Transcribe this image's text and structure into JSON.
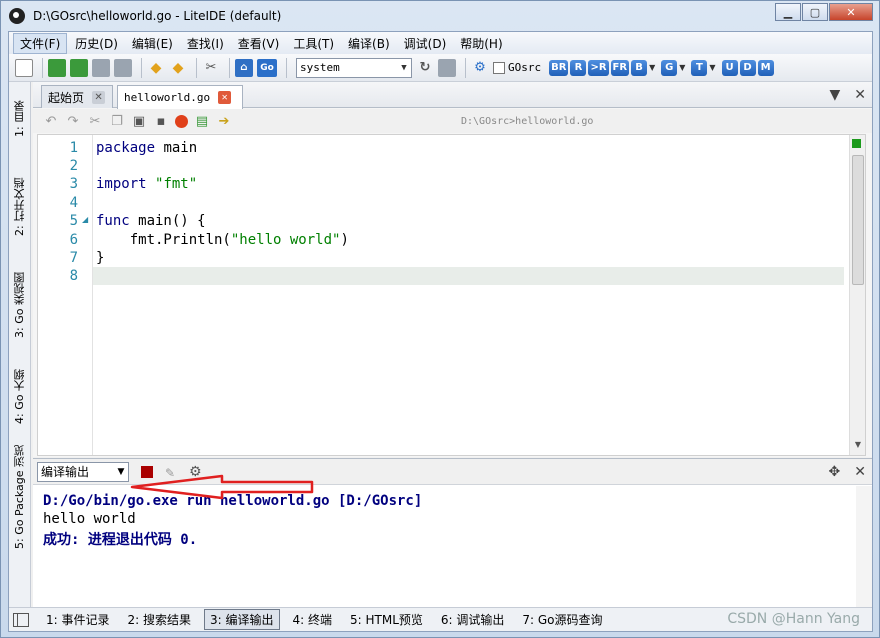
{
  "window": {
    "title": "D:\\GOsrc\\helloworld.go - LiteIDE (default)",
    "controls": [
      "minimize",
      "maximize",
      "close"
    ]
  },
  "menubar": {
    "items": [
      "文件(F)",
      "历史(D)",
      "编辑(E)",
      "查找(I)",
      "查看(V)",
      "工具(T)",
      "编译(B)",
      "调试(D)",
      "帮助(H)"
    ]
  },
  "toolbar": {
    "env_select": "system",
    "gosrc_label": "GOsrc",
    "gosrc_checked": false,
    "go_button": "Go",
    "build_buttons": [
      "BR",
      "R",
      ">R",
      "FR",
      "B",
      "G",
      "T",
      "U",
      "D",
      "M"
    ]
  },
  "left_dock": {
    "tabs": [
      "1: 目录",
      "2: 打开文档",
      "3: Go 类视图",
      "4: Go 大纲",
      "5: Go Package 浏览"
    ]
  },
  "editor": {
    "tabs": [
      {
        "label": "起始页",
        "active": false
      },
      {
        "label": "helloworld.go",
        "active": true
      }
    ],
    "file_path": "D:\\GOsrc>helloworld.go",
    "line_numbers": [
      "1",
      "2",
      "3",
      "4",
      "5",
      "6",
      "7",
      "8"
    ],
    "code": {
      "l1_kw": "package",
      "l1_rest": " main",
      "l3_kw": "import",
      "l3_str": "\"fmt\"",
      "l5_kw": "func",
      "l5_rest": " main() {",
      "l6_pre": "    fmt.Println(",
      "l6_str": "\"hello world\"",
      "l6_post": ")",
      "l7": "}"
    }
  },
  "output": {
    "selector": "编译输出",
    "command_line": "D:/Go/bin/go.exe run helloworld.go [D:/GOsrc]",
    "program_output": "hello world",
    "status_line": "成功: 进程退出代码 0."
  },
  "statusbar": {
    "tabs": [
      {
        "label": "1: 事件记录",
        "active": false
      },
      {
        "label": "2: 搜索结果",
        "active": false
      },
      {
        "label": "3: 编译输出",
        "active": true
      },
      {
        "label": "4: 终端",
        "active": false
      },
      {
        "label": "5: HTML预览",
        "active": false
      },
      {
        "label": "6: 调试输出",
        "active": false
      },
      {
        "label": "7: Go源码查询",
        "active": false
      }
    ],
    "watermark": "CSDN @Hann Yang"
  },
  "colors": {
    "keyword": "#00007f",
    "string": "#008000",
    "line_number": "#2a8aa8",
    "annotation_arrow": "#e02020"
  }
}
